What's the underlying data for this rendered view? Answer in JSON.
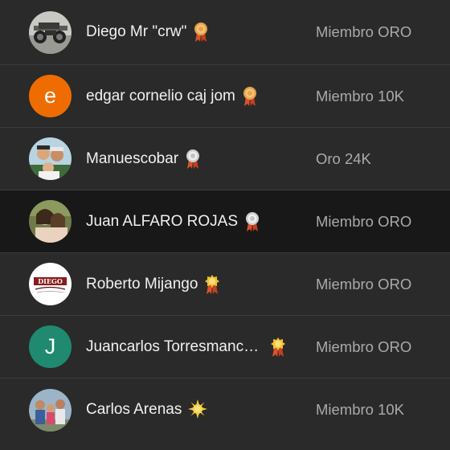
{
  "members": [
    {
      "name": "Diego Mr \"crw\"",
      "level": "Miembro ORO",
      "avatar_type": "photo",
      "avatar_icon": "motorcycle-photo",
      "badge_icon": "gold-medal-icon",
      "badge_color": "#e8a24a"
    },
    {
      "name": "edgar cornelio caj jom",
      "level": "Miembro 10K",
      "avatar_type": "letter",
      "avatar_letter": "e",
      "avatar_color": "#ef6c00",
      "badge_icon": "gold-medal-icon",
      "badge_color": "#e8a24a"
    },
    {
      "name": "Manuescobar",
      "level": "Oro 24K",
      "avatar_type": "photo",
      "avatar_icon": "group-selfie-photo",
      "badge_icon": "silver-medal-icon",
      "badge_color": "#d8d8d8"
    },
    {
      "name": "Juan ALFARO ROJAS",
      "level": "Miembro ORO",
      "avatar_type": "photo",
      "avatar_icon": "couple-photo",
      "badge_icon": "silver-medal-icon",
      "badge_color": "#d8d8d8"
    },
    {
      "name": "Roberto Mijango",
      "level": "Miembro ORO",
      "avatar_type": "photo",
      "avatar_icon": "diego-logo",
      "badge_icon": "yellow-medal-icon",
      "badge_color": "#f2c230"
    },
    {
      "name": "Juancarlos Torresmanc…",
      "level": "Miembro ORO",
      "avatar_type": "letter",
      "avatar_letter": "J",
      "avatar_color": "#1f8a70",
      "badge_icon": "yellow-medal-icon",
      "badge_color": "#f2c230"
    },
    {
      "name": "Carlos Arenas",
      "level": "Miembro 10K",
      "avatar_type": "photo",
      "avatar_icon": "family-photo",
      "badge_icon": "sun-icon",
      "badge_color": "#f7c531"
    }
  ],
  "highlight_index": 3,
  "colors": {
    "background": "#2a2a2a",
    "highlight": "#181818",
    "divider": "#3c3c3c",
    "name_text": "#f1f1f1",
    "level_text": "#aaaaaa"
  }
}
